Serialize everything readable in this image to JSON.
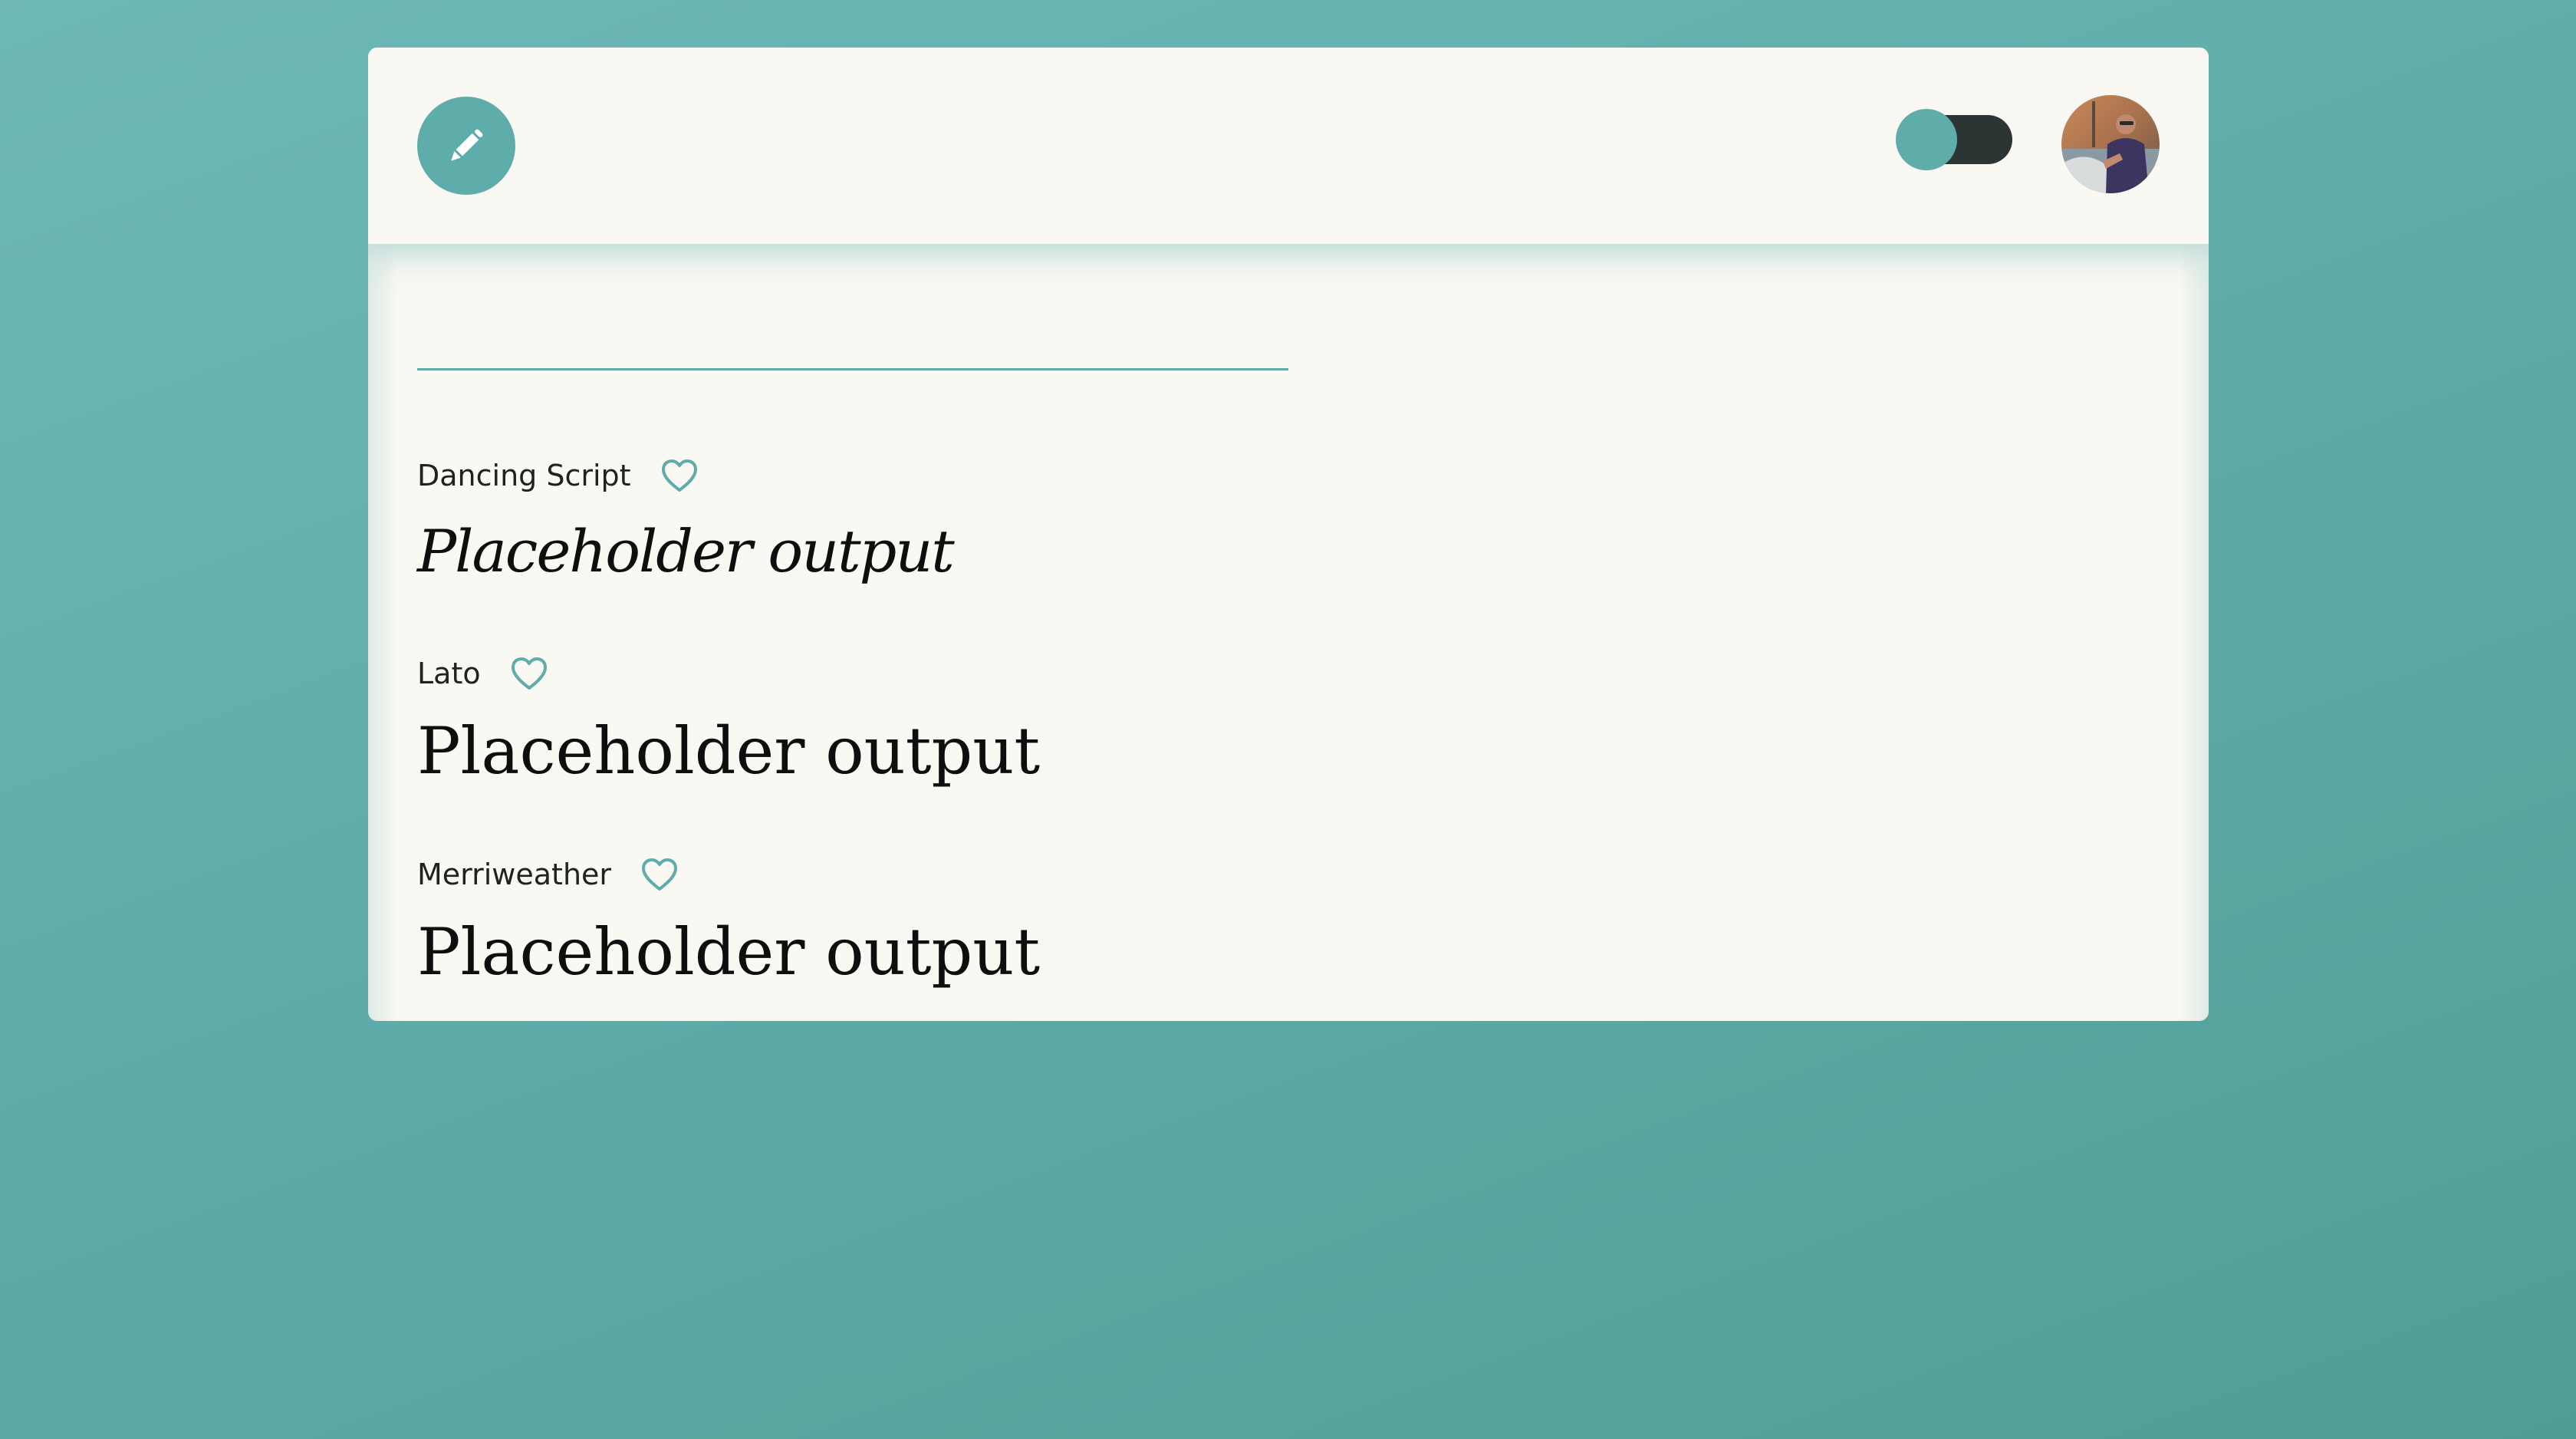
{
  "header": {
    "logo_icon": "pencil-icon",
    "theme_toggle": {
      "state": "on",
      "icon": "toggle-switch"
    },
    "avatar_icon": "user-avatar"
  },
  "search": {
    "value": "",
    "placeholder": ""
  },
  "fonts": [
    {
      "name": "Dancing Script",
      "preview": "Placeholder output",
      "favorite_icon": "heart-outline-icon"
    },
    {
      "name": "Lato",
      "preview": "Placeholder output",
      "favorite_icon": "heart-outline-icon"
    },
    {
      "name": "Merriweather",
      "preview": "Placeholder output",
      "favorite_icon": "heart-outline-icon"
    }
  ],
  "colors": {
    "accent": "#5fadaa",
    "card_bg": "#f9f8f3",
    "toggle_track": "#2c3533",
    "text": "#1e2322"
  }
}
